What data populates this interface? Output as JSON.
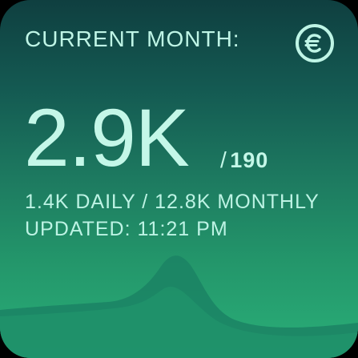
{
  "widget": {
    "title": "CURRENT MONTH:",
    "logo_icon": "euro-coin-icon",
    "big_value": "2.9K",
    "suffix_separator": "/",
    "suffix_value": "190",
    "stats_line": "1.4K DAILY / 12.8K MONTHLY",
    "updated_line": "UPDATED: 11:21 PM"
  },
  "colors": {
    "text": "#bff5e6",
    "bg_top": "#0f3f40",
    "bg_bottom": "#2aaf78",
    "wave": "#1f8f6c"
  }
}
